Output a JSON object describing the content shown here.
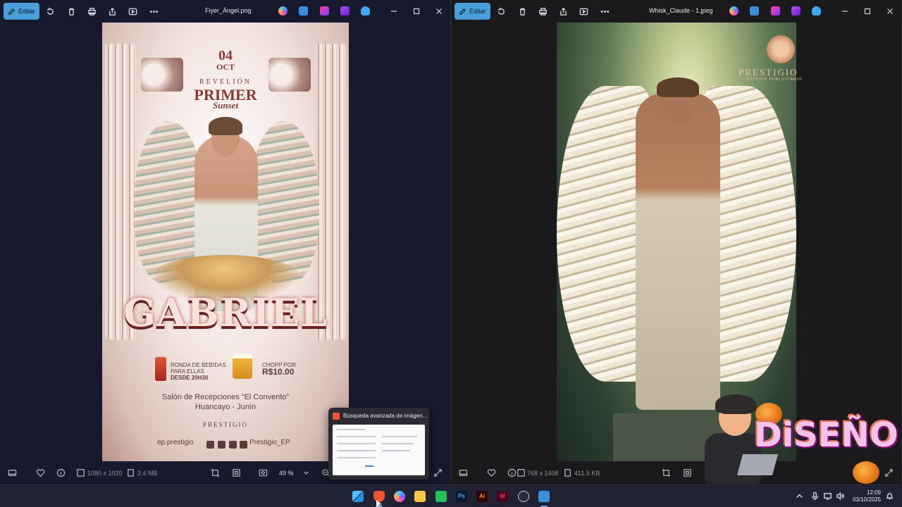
{
  "left_window": {
    "edit_label": "Editar",
    "title": "Fiyer_Ángel.png",
    "status": {
      "dimensions": "1080 x 1920",
      "size": "2.4 MB",
      "zoom": "49 %"
    },
    "poster": {
      "day": "04",
      "month": "OCT",
      "event_line1": "REVELIÓN",
      "event_line2": "PRIMER",
      "event_line3": "Sunset",
      "name": "GABRIEL",
      "drinks_text": [
        "RONDA DE BEBIDAS",
        "PARA ELLAS",
        "DESDE 20H30"
      ],
      "chopp_label": "CHOPP POR",
      "chopp_price": "R$10.00",
      "venue": "Salón de Recepciones “El Convento”",
      "location": "Huancayo - Junín",
      "brand": "PRESTIGIO",
      "social_left": "ep.prestigio",
      "social_right": "Prestigio_EP"
    }
  },
  "right_window": {
    "edit_label": "Editar",
    "title": "Whisk_Claude - 1.jpeg",
    "status": {
      "dimensions": "768 x 1408",
      "size": "411.5 KB"
    },
    "brand": "PRESTIGIO",
    "brand_sub": "ESTUDIO PUBLICITARIO"
  },
  "preview_popup": {
    "title": "Búsqueda avanzada de imágen..."
  },
  "sticker": {
    "text": "DiSEÑO"
  },
  "clock": {
    "time": "12:09",
    "date": "03/10/2025"
  }
}
